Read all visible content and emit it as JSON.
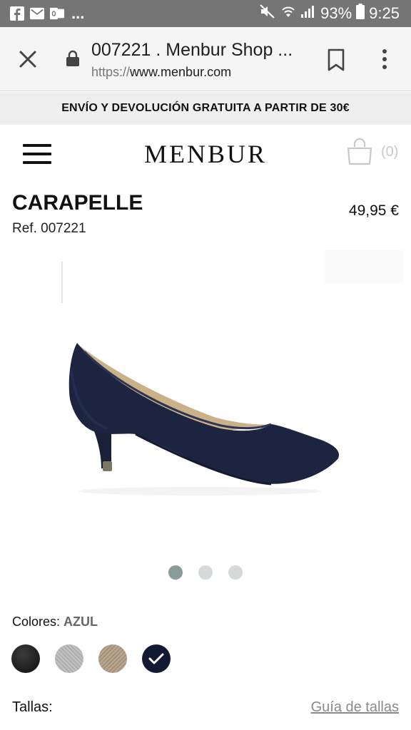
{
  "status_bar": {
    "battery": "93%",
    "time": "9:25",
    "overflow": "..."
  },
  "browser": {
    "title": "007221 . Menbur Shop ...",
    "url_scheme": "https://",
    "url_host": "www.menbur.com"
  },
  "promo": {
    "text": "ENVÍO Y DEVOLUCIÓN GRATUITA A PARTIR DE 30€"
  },
  "header": {
    "logo": "MENBUR",
    "cart_count": "(0)"
  },
  "product": {
    "name": "CARAPELLE",
    "ref": "Ref. 007221",
    "price": "49,95 €",
    "image_count": 3,
    "active_image": 0
  },
  "colors": {
    "label": "Colores:",
    "selected": "AZUL",
    "options": [
      "black",
      "grey",
      "beige",
      "navy"
    ]
  },
  "sizes": {
    "label": "Tallas:",
    "guide_link": "Guía de tallas"
  },
  "theme": {
    "status_bar_bg": "#757575",
    "promo_bg": "#efefef",
    "shoe_color": "#1c2440",
    "lining_color": "#cbb188",
    "active_dot": "#8a9c99"
  }
}
